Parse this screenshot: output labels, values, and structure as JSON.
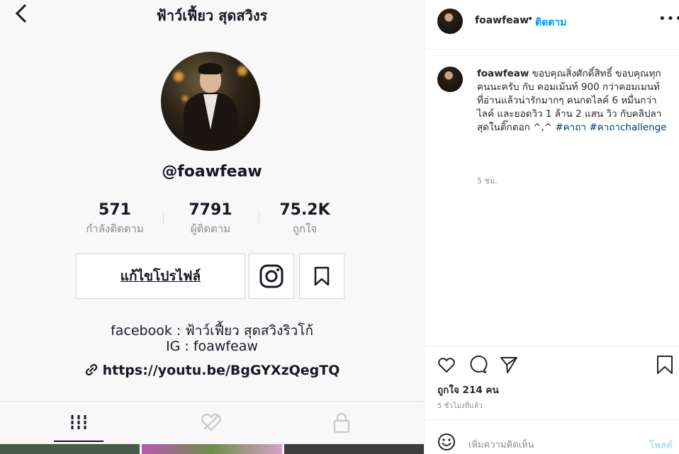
{
  "tiktok": {
    "profile_name": "ฟ้าว์เฟี้ยว สุดสวิงร",
    "handle": "@foawfeaw",
    "stats": [
      {
        "value": "571",
        "label": "กำลังติดตาม"
      },
      {
        "value": "7791",
        "label": "ผู้ติดตาม"
      },
      {
        "value": "75.2K",
        "label": "ถูกใจ"
      }
    ],
    "edit_profile_label": "แก้ไขโปรไฟล์",
    "bio_line1": "facebook : ฟ้าว์เฟี้ยว สุดสวิงริวโก้",
    "bio_line2": "IG : foawfeaw",
    "link": "https://youtu.be/BgGYXzQegTQ",
    "icons": {
      "back": "chevron-left-icon",
      "instagram": "instagram-icon",
      "bookmark": "bookmark-icon",
      "tab_videos": "grid-icon",
      "tab_liked": "heart-hidden-icon",
      "tab_private": "lock-icon",
      "link": "link-icon"
    }
  },
  "post": {
    "username": "foawfeaw",
    "separator": "•",
    "follow_label": "ติดตาม",
    "more_label": "•••",
    "caption_user": "foawfeaw",
    "caption_text": "ขอบคุณสิ่งศักดิ์สิทธิ์ ขอบคุณทุกคนนะครับ กับ คอมเม้นท์ 900 กว่าคอมเมนท์ ที่อ่านแล้วน่ารักมากๆ คนกดไลค์ 6 หมื่นกว่าไลค์ และยอดวิว 1 ล้าน 2 แสน วิว กับคลิปลาสุดในติ๊กตอก ^,^",
    "hashtag1": "#คาถา",
    "hashtag2": "#คาถาchallenge",
    "caption_time": "5 ชม.",
    "likes": "ถูกใจ 214 คน",
    "post_time": "5 ชั่วโมงที่แล้ว",
    "comment_placeholder": "เพิ่มความคิดเห็น",
    "post_button": "โพสต์"
  },
  "colors": {
    "accent": "#0095f6",
    "hashtag": "#00376b",
    "post_disabled": "#b2dffc"
  }
}
